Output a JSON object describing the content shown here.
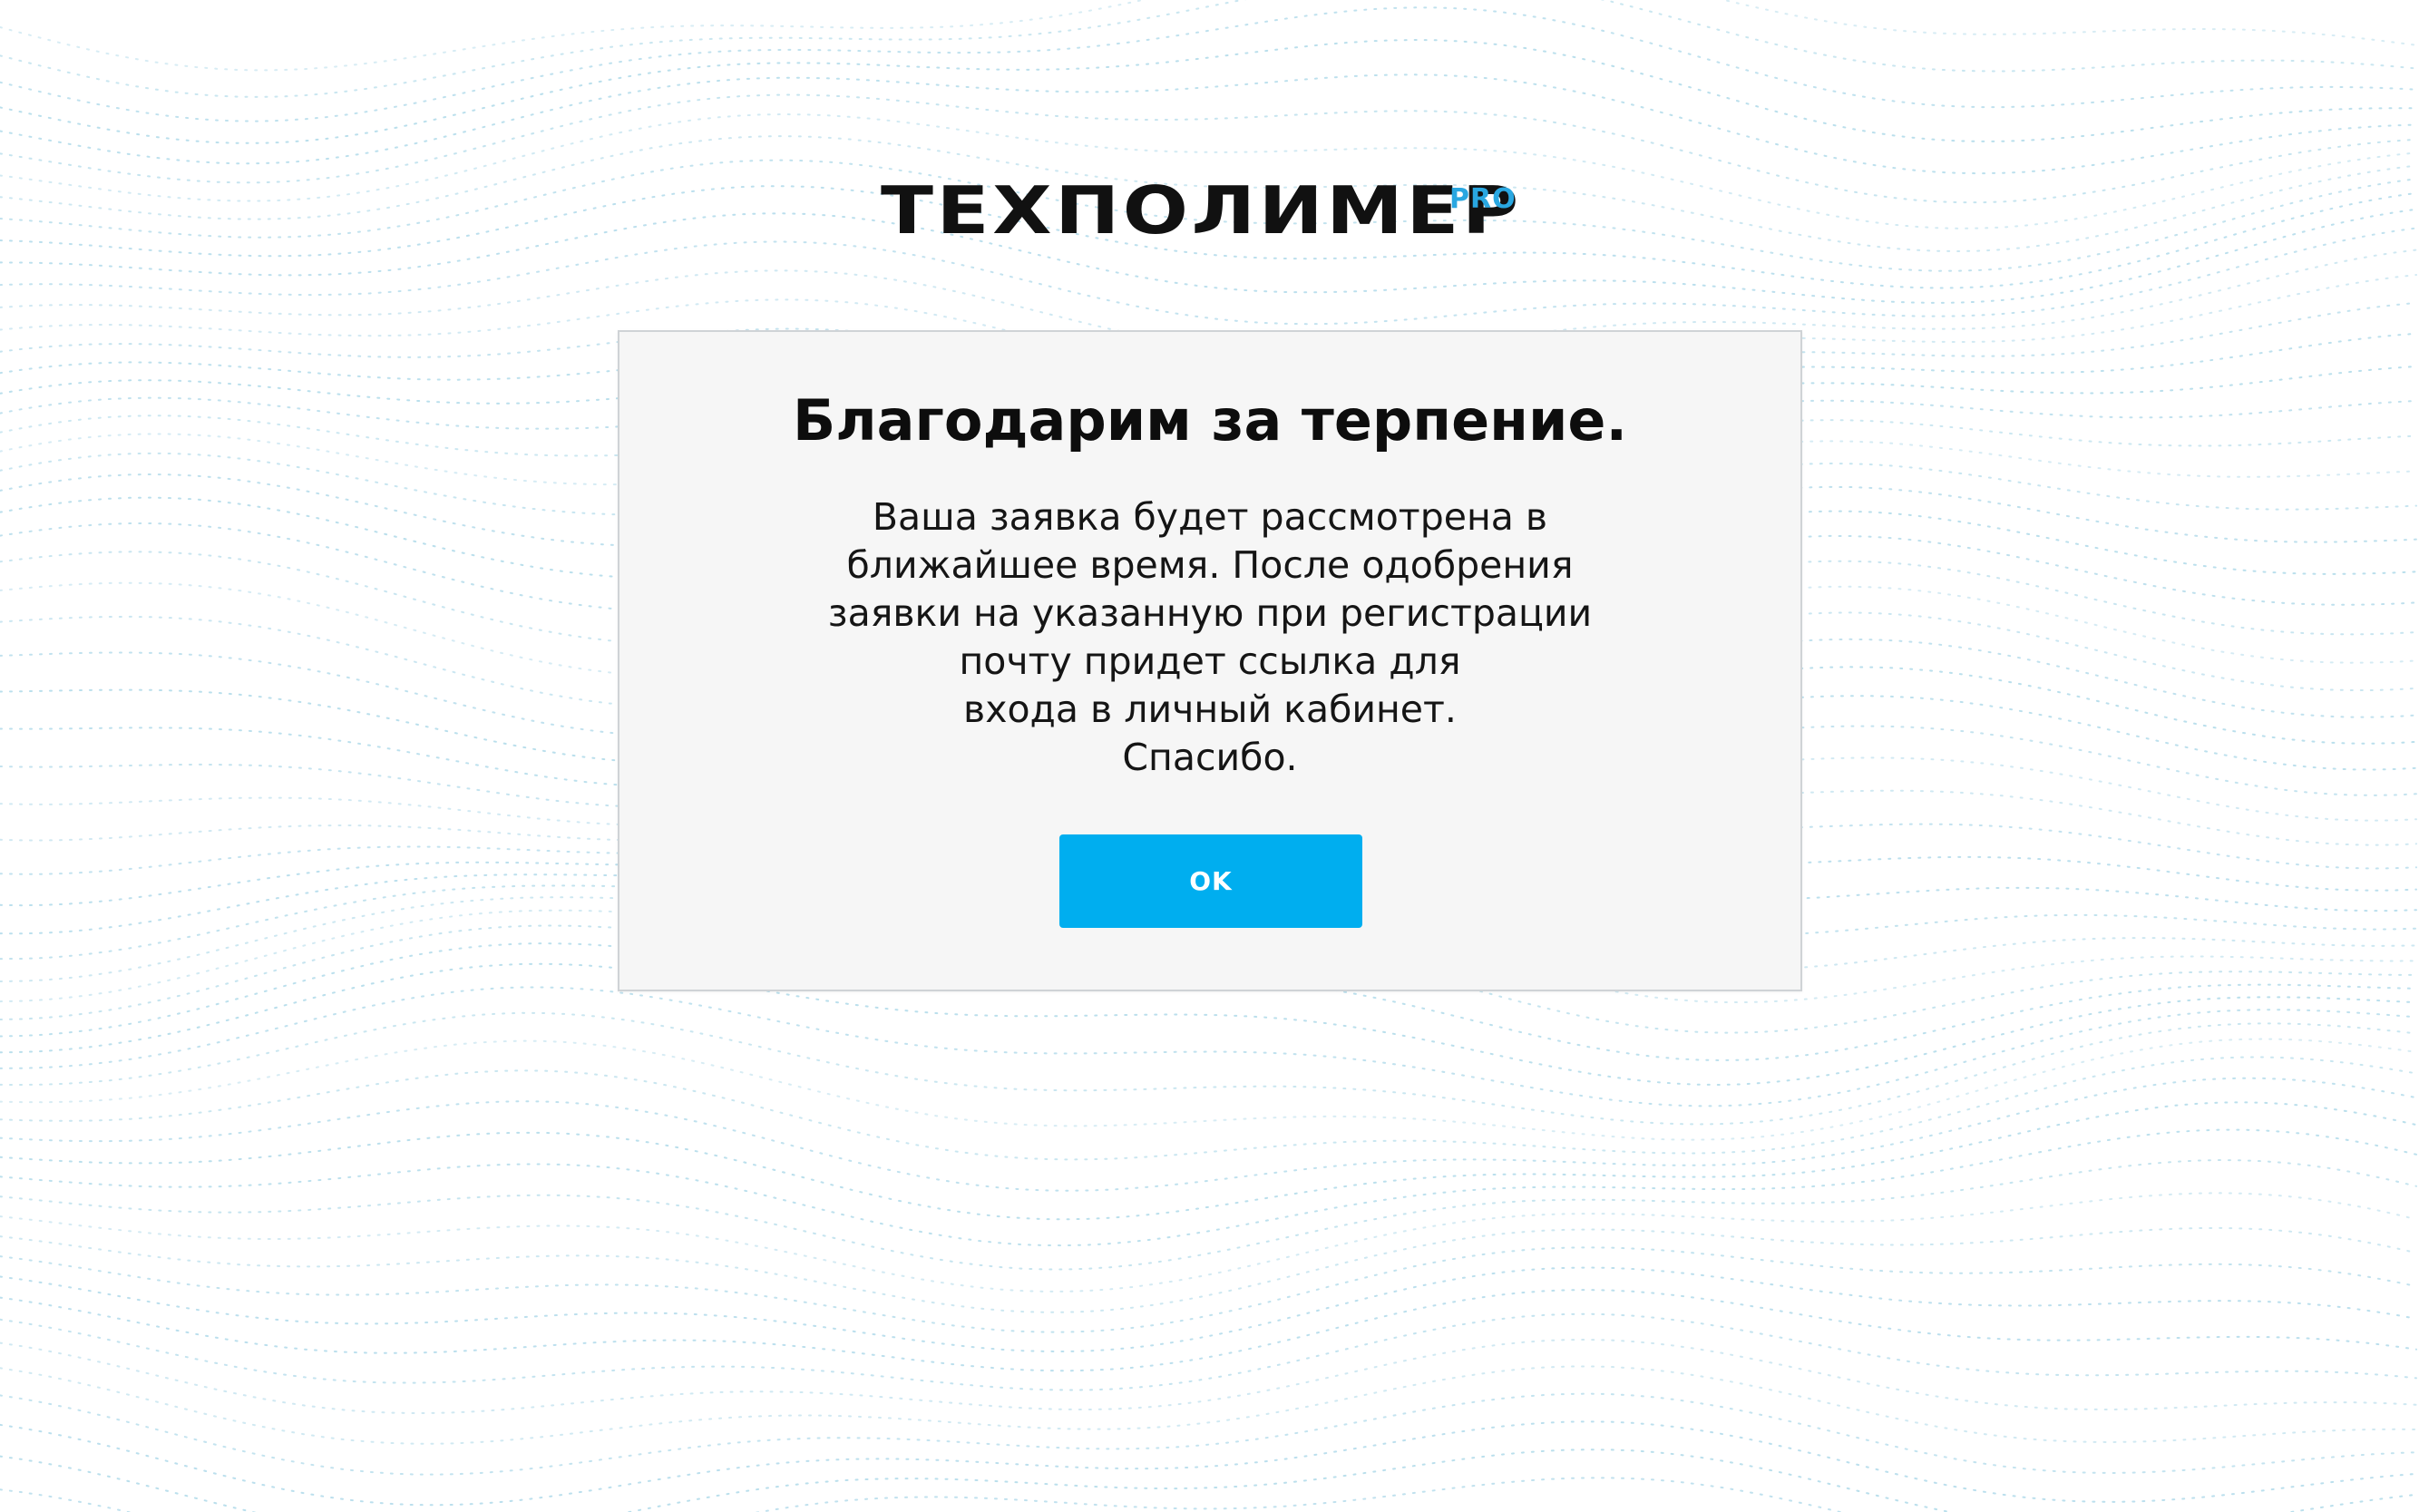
{
  "logo": {
    "main": "ТЕХПОЛИМЕР",
    "suffix": "PRO"
  },
  "dialog": {
    "title": "Благодарим за терпение.",
    "message_lines": [
      "Ваша заявка будет рассмотрена в",
      "ближайшее время. После одобрения",
      "заявки на указанную при регистрации",
      "почту придет ссылка для",
      "входа в личный кабинет.",
      "Спасибо."
    ],
    "ok_label": "OK"
  },
  "colors": {
    "accent": "#00aeef",
    "logo_pro": "#29a7e1",
    "background_waves": "#8cc9e0"
  }
}
